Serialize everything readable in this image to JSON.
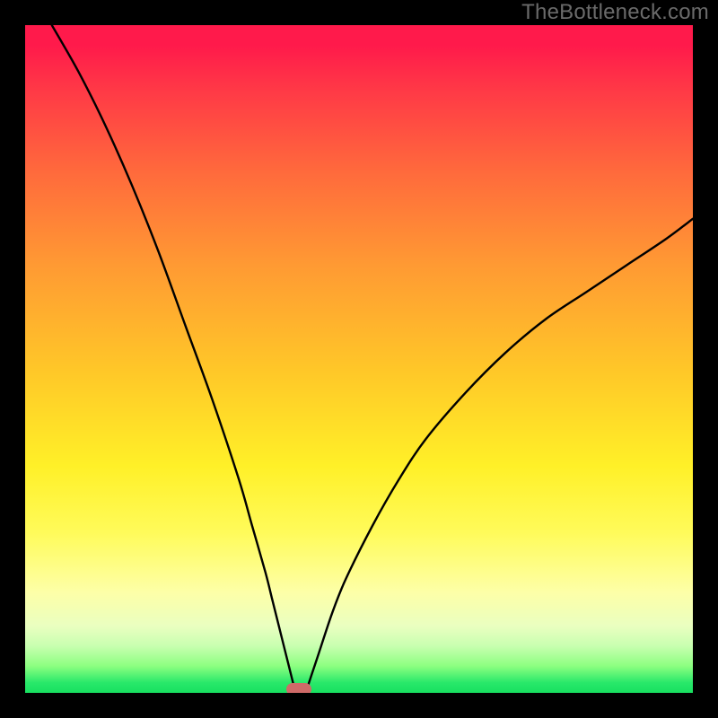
{
  "watermark": "TheBottleneck.com",
  "colors": {
    "frame": "#000000",
    "curve": "#000000",
    "marker": "#cf6a68",
    "gradient_stops": [
      "#ff1a4b",
      "#ff3a46",
      "#ff6a3c",
      "#ff9a33",
      "#ffc828",
      "#fff028",
      "#fffb5a",
      "#fdffa8",
      "#eaffc0",
      "#c8ffb0",
      "#8cff80",
      "#28e86a",
      "#18e060"
    ]
  },
  "chart_data": {
    "type": "line",
    "title": "",
    "xlabel": "",
    "ylabel": "",
    "xlim": [
      0,
      100
    ],
    "ylim": [
      0,
      100
    ],
    "series": [
      {
        "name": "left-branch",
        "x": [
          4,
          8,
          12,
          16,
          20,
          24,
          28,
          32,
          34,
          36,
          37,
          38,
          39,
          40,
          40.5
        ],
        "y": [
          100,
          93,
          85,
          76,
          66,
          55,
          44,
          32,
          25,
          18,
          14,
          10,
          6,
          2,
          0
        ]
      },
      {
        "name": "right-branch",
        "x": [
          42,
          43,
          44,
          46,
          48,
          52,
          56,
          60,
          66,
          72,
          78,
          84,
          90,
          96,
          100
        ],
        "y": [
          0,
          3,
          6,
          12,
          17,
          25,
          32,
          38,
          45,
          51,
          56,
          60,
          64,
          68,
          71
        ]
      }
    ],
    "marker": {
      "name": "bottleneck-point",
      "x": 41,
      "y": 0.5
    }
  }
}
